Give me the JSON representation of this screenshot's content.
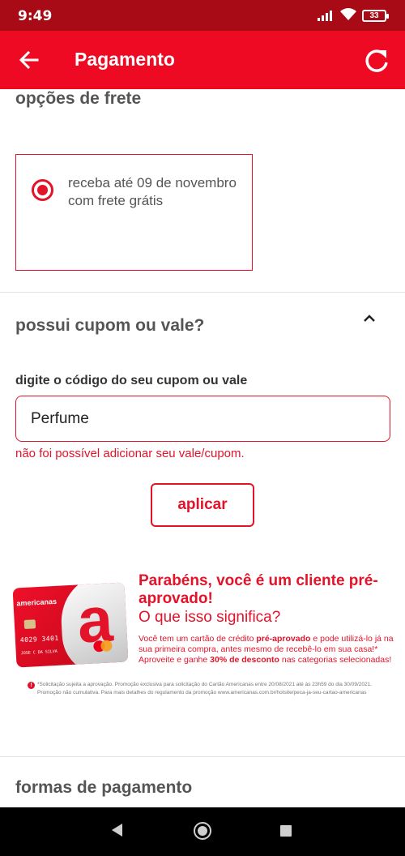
{
  "status_bar": {
    "time": "9:49",
    "battery": "33"
  },
  "header": {
    "title": "Pagamento"
  },
  "shipping": {
    "section_title": "opções de frete",
    "option_label": "receba até 09 de novembro com frete grátis"
  },
  "coupon": {
    "section_title": "possui cupom ou vale?",
    "field_label": "digite o código do seu cupom ou vale",
    "input_value": "Perfume",
    "error_message": "não foi possível adicionar seu vale/cupom.",
    "apply_label": "aplicar"
  },
  "promo": {
    "card_brand": "americanas",
    "card_number": "4029 3401",
    "card_holder": "JOSE C DA SILVA",
    "headline": "Parabéns, você é um cliente pré-aprovado!",
    "subheadline": "O que isso significa?",
    "body_pre": "Você tem um cartão de crédito ",
    "body_strong": "pré-aprovado",
    "body_mid": " e pode utilizá-lo já na sua primeira compra, antes mesmo de recebê-lo em sua casa!* Aproveite e ganhe ",
    "body_strong2": "30% de desconto",
    "body_post": " nas categorias selecionadas!",
    "fine_print": "*Solicitação sujeita a aprovação. Promoção exclusiva para solicitação do Cartão Americanas entre 20/08/2021 até às 23h59 do dia 30/09/2021. Promoção não cumulativa. Para mais detalhes do regulamento da promoção www.americanas.com.br/hotsite/peca-ja-seu-cartao-americanas"
  },
  "payment": {
    "section_title": "formas de pagamento"
  },
  "colors": {
    "brand_red": "#ee0a23",
    "status_red": "#a80a16",
    "error_red": "#e3132a"
  },
  "icons": [
    "back-arrow-icon",
    "refresh-icon",
    "chevron-up-icon",
    "radio-selected-icon",
    "signal-icon",
    "wifi-icon",
    "battery-icon"
  ]
}
